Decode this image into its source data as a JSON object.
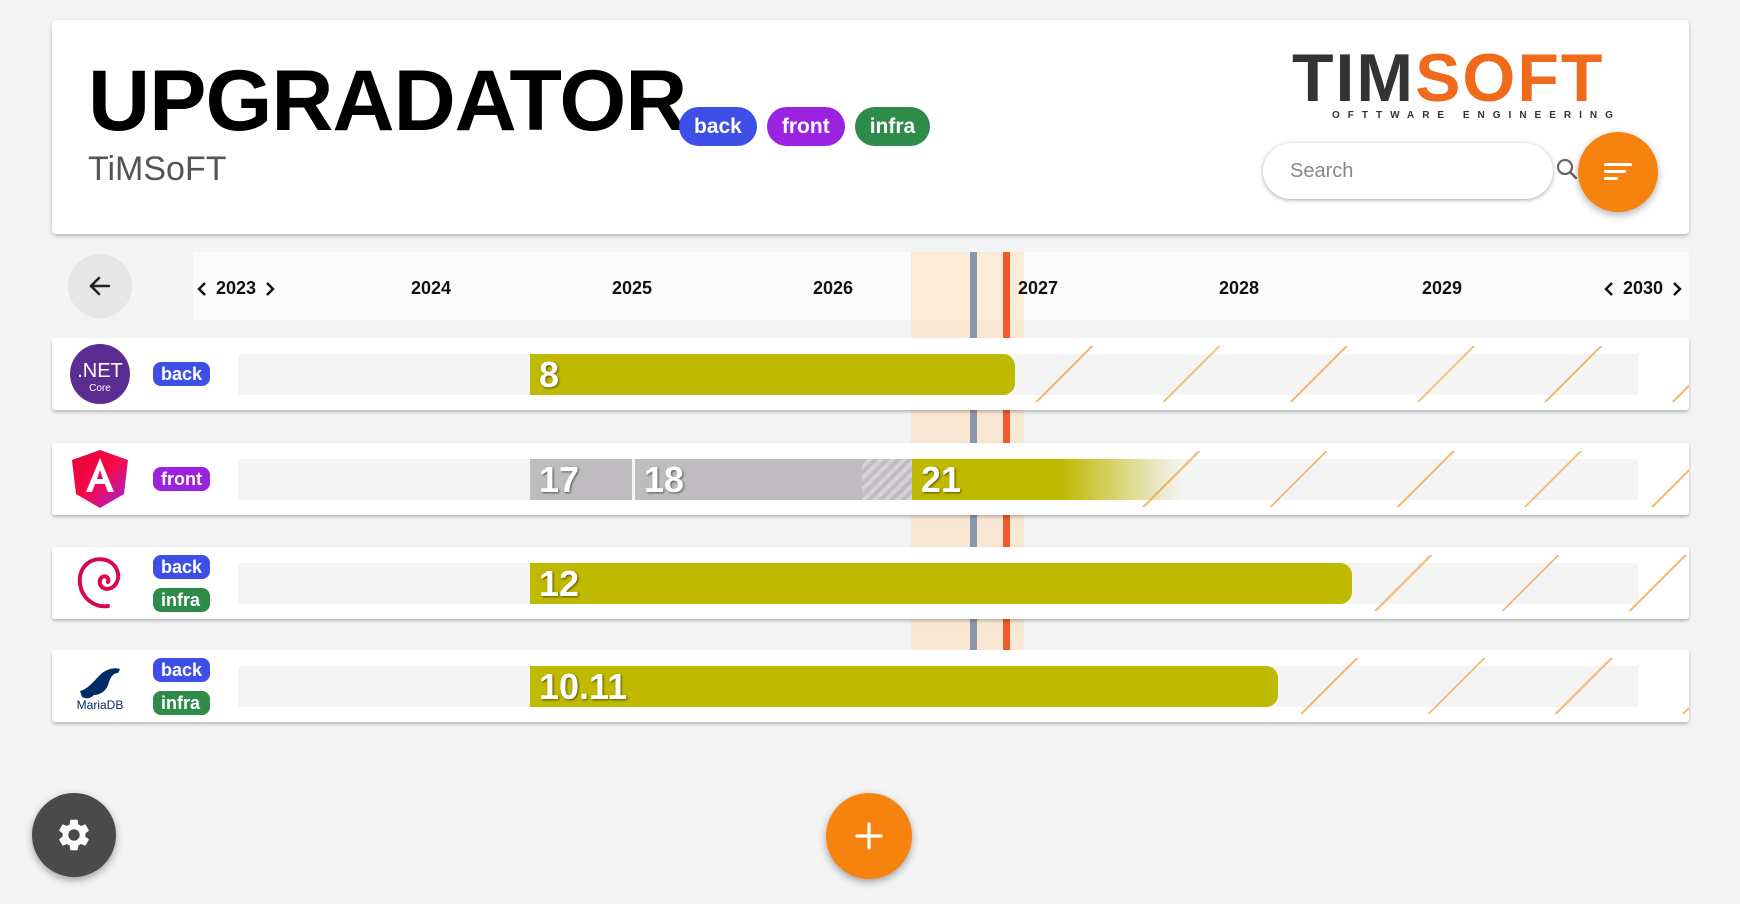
{
  "header": {
    "title": "UPGRADATOR",
    "subtitle": "TiMSoFT",
    "tags": [
      {
        "label": "back",
        "kind": "back"
      },
      {
        "label": "front",
        "kind": "front"
      },
      {
        "label": "infra",
        "kind": "infra"
      }
    ],
    "logo": {
      "part1": "TIM",
      "part2": "SOFT",
      "tagline": "OFTTWARE ENGINEERING"
    },
    "search": {
      "placeholder": "Search",
      "value": ""
    }
  },
  "timeline": {
    "years": [
      "2023",
      "2024",
      "2025",
      "2026",
      "2027",
      "2028",
      "2029",
      "2030"
    ]
  },
  "rows": [
    {
      "name": "dotnet",
      "icon": "dotnet-core-logo",
      "icon_text": ".NET",
      "icon_sub": "Core",
      "tags": [
        "back"
      ],
      "versions": [
        {
          "label": "8"
        }
      ]
    },
    {
      "name": "angular",
      "icon": "angular-logo",
      "tags": [
        "front"
      ],
      "versions": [
        {
          "label": "17"
        },
        {
          "label": "18"
        },
        {
          "label": "21"
        }
      ]
    },
    {
      "name": "debian",
      "icon": "debian-logo",
      "tags": [
        "back",
        "infra"
      ],
      "versions": [
        {
          "label": "12"
        }
      ]
    },
    {
      "name": "mariadb",
      "icon": "mariadb-logo",
      "icon_text": "MariaDB",
      "tags": [
        "back",
        "infra"
      ],
      "versions": [
        {
          "label": "10.11"
        }
      ]
    }
  ],
  "colors": {
    "accent": "#f7830f",
    "active_bar": "#bfb900",
    "old_bar": "#bfbcc0",
    "today_marker": "#ef5a2a",
    "tag_back": "#3d4fe6",
    "tag_front": "#9b22e0",
    "tag_infra": "#2e8b4a"
  }
}
